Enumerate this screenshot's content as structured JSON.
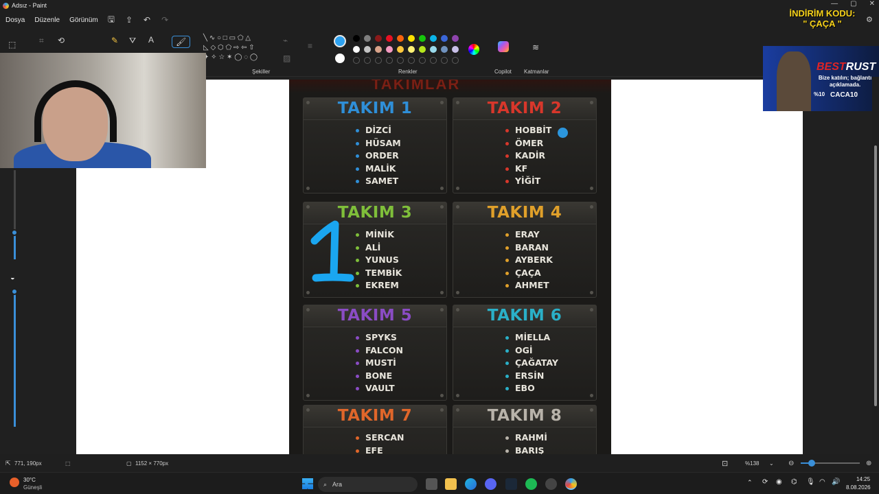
{
  "window": {
    "title": "Adsız - Paint",
    "minimize": "—",
    "maximize": "▢",
    "close": "✕"
  },
  "menu": {
    "file": "Dosya",
    "edit": "Düzenle",
    "view": "Görünüm",
    "save_icon": "save-icon",
    "share_icon": "share-icon",
    "undo_icon": "↶",
    "redo_icon": "↷"
  },
  "ribbon": {
    "shapes_label": "Şekiller",
    "colors_label": "Renkler",
    "copilot_label": "Copilot",
    "layers_label": "Katmanlar"
  },
  "colors": {
    "selected_primary": "#2ea3f2",
    "selected_secondary": "#ffffff",
    "row1": [
      "#000000",
      "#7f7f7f",
      "#8b1a1a",
      "#e81123",
      "#f7630c",
      "#fce100",
      "#16c60c",
      "#0bb4e8",
      "#3a66d8",
      "#8e44ad"
    ],
    "row2": [
      "#ffffff",
      "#c3c3c3",
      "#d9a38a",
      "#f49ac1",
      "#ffc83d",
      "#fff176",
      "#b5e61d",
      "#99d9ea",
      "#7092be",
      "#c8bfe7"
    ]
  },
  "poster": {
    "header_text": "TAKIMLAR",
    "teams": [
      {
        "name": "TAKIM 1",
        "color": "#2f8fd8",
        "members": [
          "DİZCİ",
          "HÜSAM",
          "ORDER",
          "MALİK",
          "SAMET"
        ]
      },
      {
        "name": "TAKIM 2",
        "color": "#d8372b",
        "members": [
          "HOBBİT",
          "ÖMER",
          "KADİR",
          "KF",
          "YİĞİT"
        ]
      },
      {
        "name": "TAKIM 3",
        "color": "#7fbf3a",
        "members": [
          "MİNİK",
          "ALİ",
          "YUNUS",
          "TEMBİK",
          "EKREM"
        ]
      },
      {
        "name": "TAKIM 4",
        "color": "#e0a02a",
        "members": [
          "ERAY",
          "BARAN",
          "AYBERK",
          "ÇAÇA",
          "AHMET"
        ]
      },
      {
        "name": "TAKIM 5",
        "color": "#8a4cc4",
        "members": [
          "SPYKS",
          "FALCON",
          "MUSTİ",
          "BONE",
          "VAULT"
        ]
      },
      {
        "name": "TAKIM 6",
        "color": "#2ab0c8",
        "members": [
          "MİELLA",
          "OGİ",
          "ÇAĞATAY",
          "ERSİN",
          "EBO"
        ]
      },
      {
        "name": "TAKIM 7",
        "color": "#e0662a",
        "members": [
          "SERCAN",
          "EFE"
        ]
      },
      {
        "name": "TAKIM 8",
        "color": "#b8b3aa",
        "members": [
          "RAHMİ",
          "BARIŞ"
        ]
      }
    ],
    "annotation_number": "1"
  },
  "overlay": {
    "promo_line1": "İNDİRİM KODU:",
    "promo_line2": "\" ÇAÇA \"",
    "ad_brand_1": "BEST",
    "ad_brand_2": "RUST",
    "ad_text": "Bize katılın; bağlantı açıklamada.",
    "ad_pct": "%10",
    "ad_code": "CACA10"
  },
  "status": {
    "cursor_pos": "771, 190px",
    "canvas_size": "1152 × 770px",
    "zoom": "%138"
  },
  "taskbar": {
    "weather_temp": "30°C",
    "weather_desc": "Güneşli",
    "search_placeholder": "Ara",
    "time": "14:25",
    "date": "8.08.2026"
  }
}
